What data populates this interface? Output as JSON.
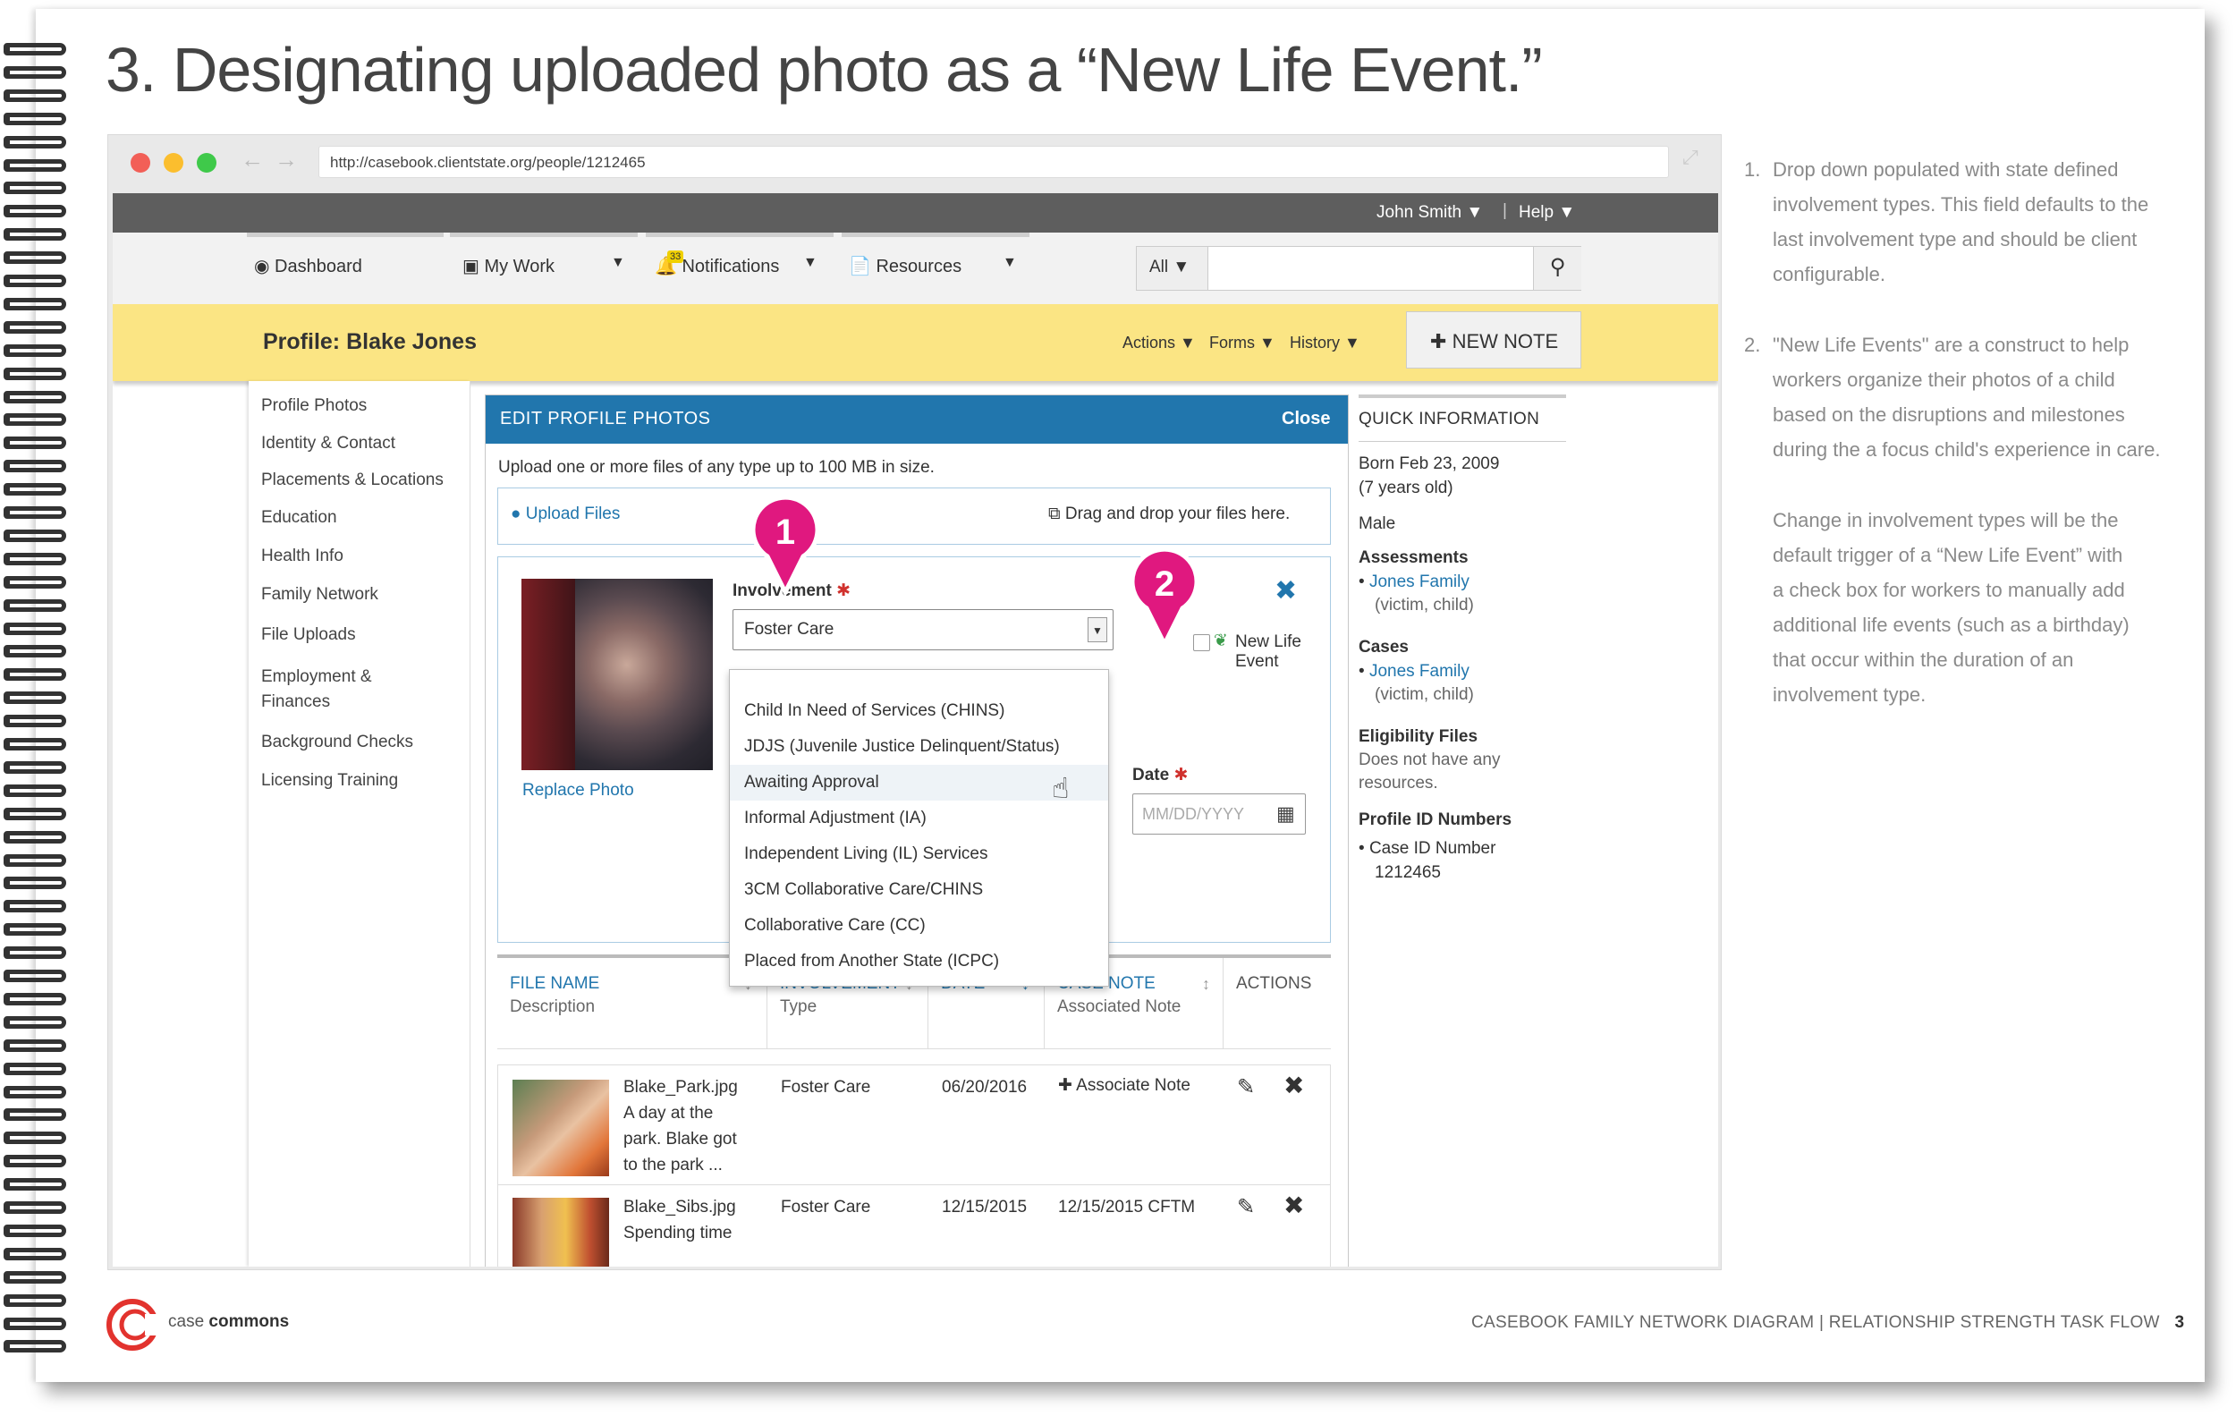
{
  "page": {
    "title": "3. Designating uploaded photo as a “New Life Event.”",
    "footer": {
      "brand_light": "case",
      "brand_bold": "commons",
      "caption": "CASEBOOK FAMILY NETWORK DIAGRAM | RELATIONSHIP STRENGTH TASK FLOW",
      "page_number": "3"
    }
  },
  "browser": {
    "url": "http://casebook.clientstate.org/people/1212465"
  },
  "topbar": {
    "user": "John Smith",
    "help": "Help"
  },
  "nav": {
    "items": [
      {
        "label": "Dashboard",
        "icon": "dashboard-icon"
      },
      {
        "label": "My Work",
        "icon": "inbox-icon"
      },
      {
        "label": "Notifications",
        "icon": "bell-icon",
        "badge": "33"
      },
      {
        "label": "Resources",
        "icon": "document-icon"
      }
    ],
    "search_scope": "All",
    "search_placeholder": ""
  },
  "profile": {
    "title": "Profile: Blake Jones",
    "menus": [
      "Actions",
      "Forms",
      "History"
    ],
    "new_note": "NEW NOTE"
  },
  "sidebar": {
    "items": [
      "Profile Photos",
      "Identity & Contact",
      "Placements & Locations",
      "Education",
      "Health Info",
      "Family Network",
      "File Uploads",
      "Employment &",
      "Finances",
      "Background Checks",
      "Licensing Training"
    ]
  },
  "modal": {
    "title": "EDIT PROFILE PHOTOS",
    "close": "Close",
    "instructions": "Upload one or more files of any type up to 100 MB in size.",
    "upload_link": "Upload Files",
    "drag_text": "Drag and drop your files here.",
    "replace_photo": "Replace Photo",
    "involvement_label": "Involvement",
    "involvement_value": "Foster Care",
    "new_life_event": "New Life Event",
    "new_life_event_checked": false,
    "date_label": "Date",
    "date_placeholder": "MM/DD/YYYY",
    "dropdown_options": [
      "Child In Need of Services (CHINS)",
      "JDJS (Juvenile Justice Delinquent/Status)",
      "Awaiting Approval",
      "Informal Adjustment (IA)",
      "Independent  Living (IL) Services",
      "3CM Collaborative Care/CHINS",
      "Collaborative Care (CC)",
      "Placed from Another State (ICPC)"
    ],
    "highlighted_option": "Awaiting Approval",
    "table": {
      "headers": [
        {
          "title": "FILE NAME",
          "sub": "Description"
        },
        {
          "title": "INVOLVEMENT",
          "sub": "Type"
        },
        {
          "title": "DATE",
          "sub": ""
        },
        {
          "title": "CASE NOTE",
          "sub": "Associated Note"
        },
        {
          "title": "ACTIONS",
          "sub": ""
        }
      ],
      "rows": [
        {
          "file": "Blake_Park.jpg",
          "desc": [
            "A day at the",
            "park. Blake got",
            "to the park ..."
          ],
          "type": "Foster Care",
          "date": "06/20/2016",
          "note": "Associate Note"
        },
        {
          "file": "Blake_Sibs.jpg",
          "desc": [
            "Spending time"
          ],
          "type": "Foster Care",
          "date": "12/15/2015",
          "note": "12/15/2015 CFTM"
        }
      ]
    }
  },
  "quick_info": {
    "title": "QUICK INFORMATION",
    "born": "Born Feb 23, 2009",
    "age": "(7 years old)",
    "gender": "Male",
    "assessments_label": "Assessments",
    "assessment_link": "Jones Family",
    "assessment_role": "(victim, child)",
    "cases_label": "Cases",
    "case_link": "Jones Family",
    "case_role": "(victim, child)",
    "eligibility_label": "Eligibility Files",
    "eligibility_text": [
      "Does not have any",
      "resources."
    ],
    "profile_ids_label": "Profile ID Numbers",
    "case_id_label": "Case ID Number",
    "case_id": "1212465"
  },
  "callouts": {
    "one": "1",
    "two": "2"
  },
  "notes": {
    "n1_num": "1.",
    "n1": [
      "Drop down populated with state defined",
      "involvement types. This field defaults to the",
      "last involvement type and should be client",
      "configurable."
    ],
    "n2_num": "2.",
    "n2": [
      "\"New Life Events\" are a construct to help",
      "workers organize their photos of a child",
      "based on the disruptions and milestones",
      "during the a focus child's experience in care."
    ],
    "n3": [
      "Change in involvement types will be the",
      "default trigger of a “New Life Event” with",
      "a check box for workers to manually add",
      "additional life events (such as a birthday)",
      "that occur within the duration of an",
      "involvement type."
    ]
  },
  "colors": {
    "accent": "#2176ad",
    "profile_bar": "#fbe584",
    "callout": "#e0187f",
    "required": "#d0312d"
  }
}
